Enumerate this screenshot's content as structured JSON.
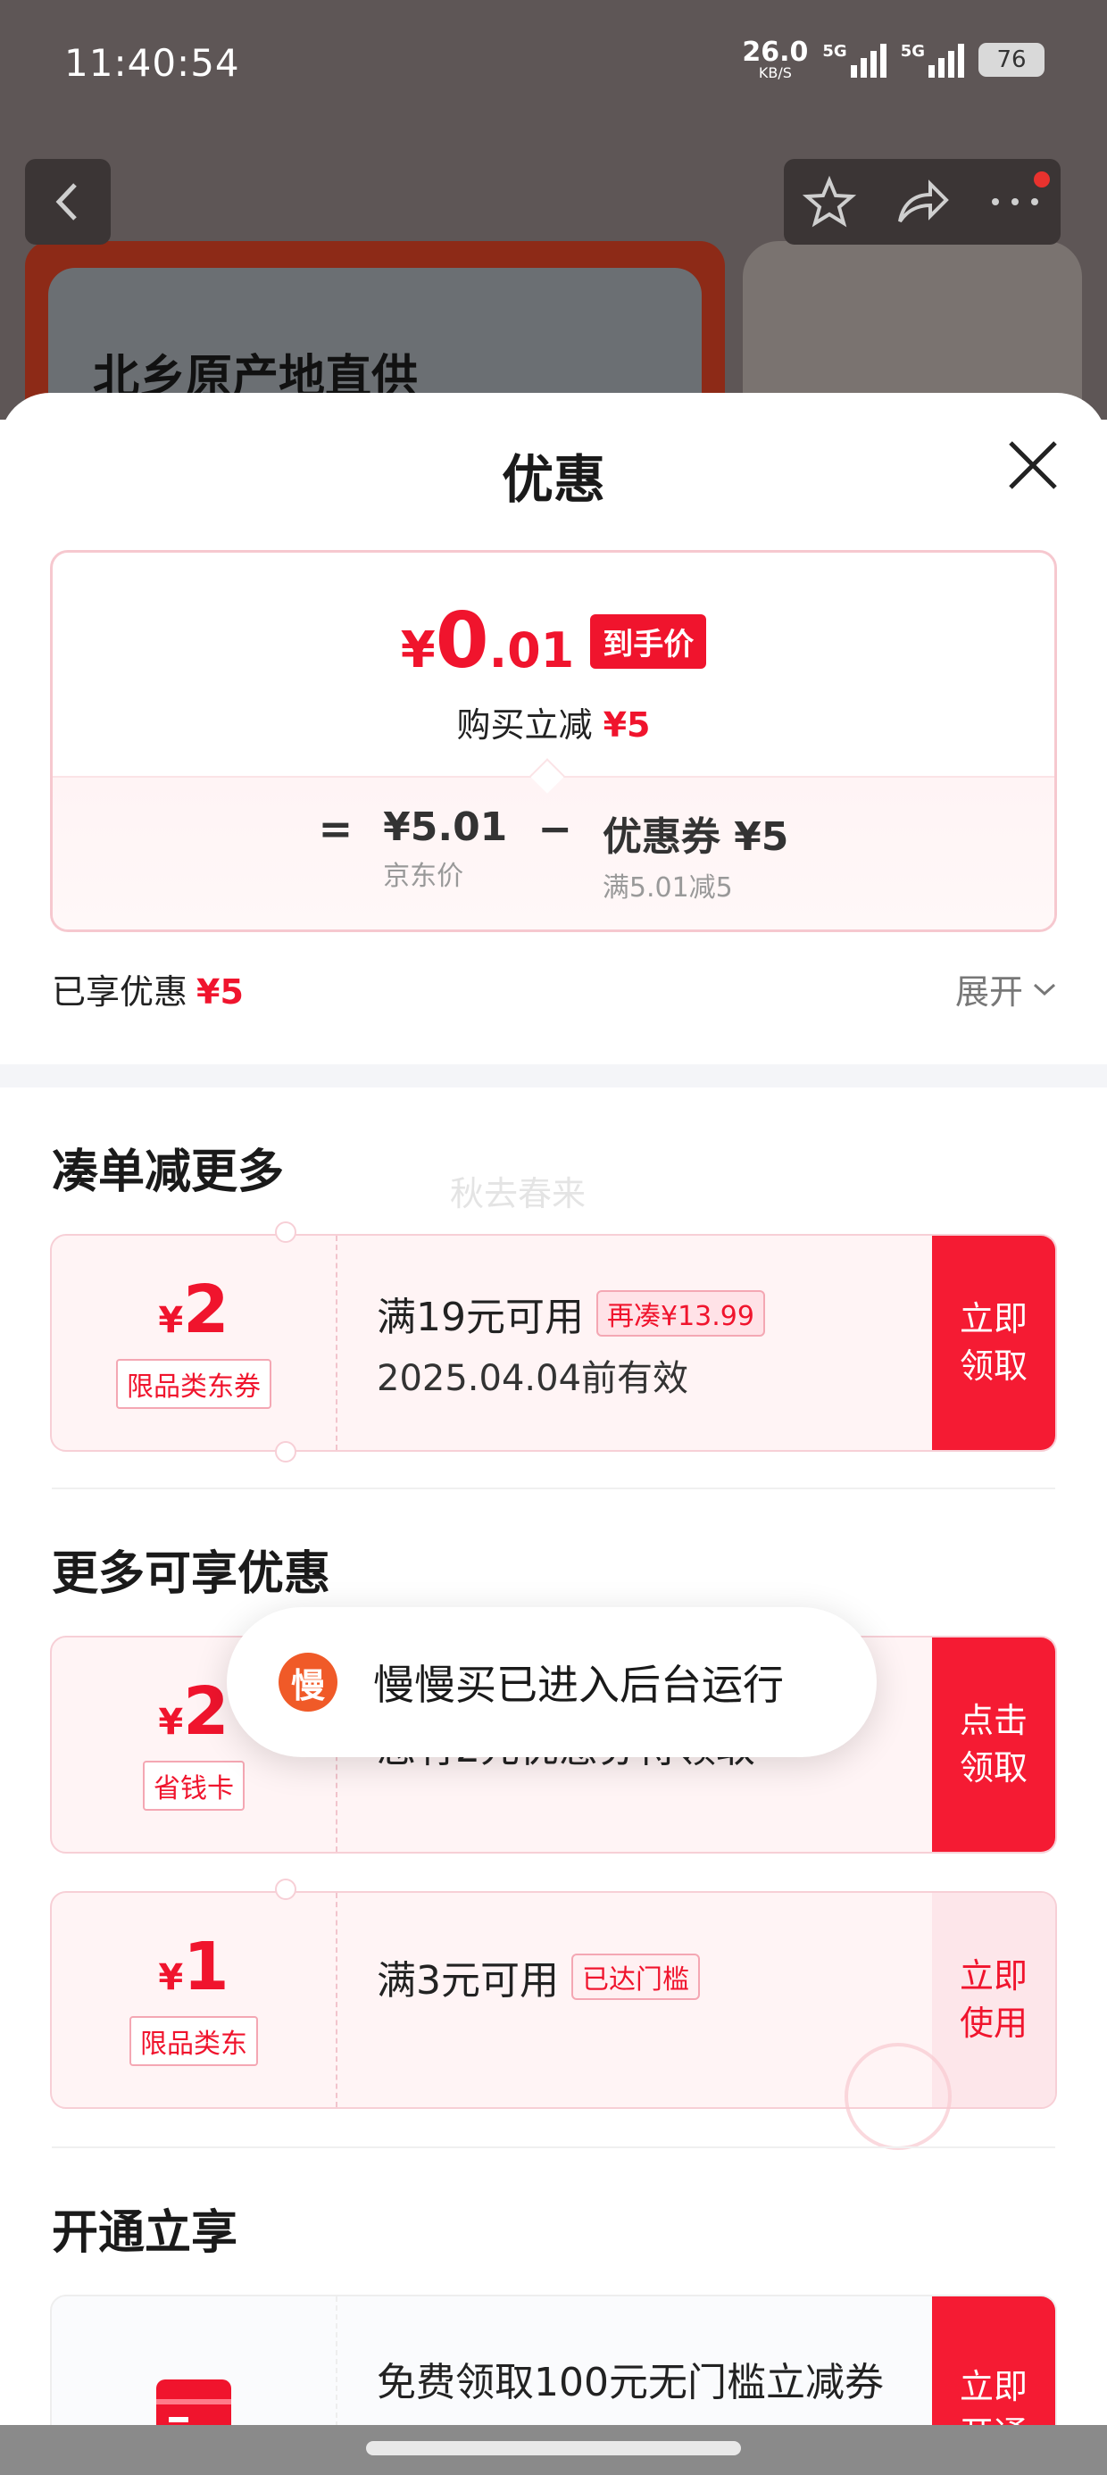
{
  "status_bar": {
    "time": "11:40:54",
    "net_speed": "26.0",
    "net_unit": "KB/S",
    "sim1_label": "5G",
    "sim2_label": "5G",
    "battery": "76"
  },
  "product_page": {
    "banner_title": "北乡原产地直供"
  },
  "sheet": {
    "title": "优惠",
    "price_card": {
      "currency": "¥",
      "price_int": "0",
      "price_dec": ".01",
      "final_tag": "到手价",
      "buy_reduce_label": "购买立减",
      "buy_reduce_value": "¥5",
      "equals": "=",
      "minus": "−",
      "jd_price_value": "¥5.01",
      "jd_price_label": "京东价",
      "coupon_value": "优惠券 ¥5",
      "coupon_label": "满5.01减5"
    },
    "enjoyed_label": "已享优惠",
    "enjoyed_value": "¥5",
    "expand_label": "展开"
  },
  "section_more_orders": {
    "title": "凑单减更多",
    "watermark": "秋去春来",
    "coupon": {
      "currency": "¥",
      "amount": "2",
      "tag": "限品类东券",
      "condition": "满19元可用",
      "badge": "再凑¥13.99",
      "validity": "2025.04.04前有效",
      "action": "立即\n领取"
    }
  },
  "section_more_discounts": {
    "title": "更多可享优惠",
    "coupons": [
      {
        "currency": "¥",
        "amount": "2",
        "tag": "省钱卡",
        "text": "您有2元优惠券待领取",
        "action": "点击\n领取"
      },
      {
        "currency": "¥",
        "amount": "1",
        "tag": "限品类东",
        "condition": "满3元可用",
        "badge": "已达门槛",
        "action": "立即\n使用"
      }
    ]
  },
  "toast": {
    "icon_char": "慢",
    "text": "慢慢买已进入后台运行"
  },
  "section_open": {
    "title": "开通立享",
    "card": {
      "icon": "card-icon",
      "text": "免费领取100元无门槛立减券",
      "action": "立即\n开通"
    }
  },
  "colors": {
    "accent": "#f0142d",
    "action_bg": "#f51b33",
    "coupon_bg": "#fff4f5"
  }
}
